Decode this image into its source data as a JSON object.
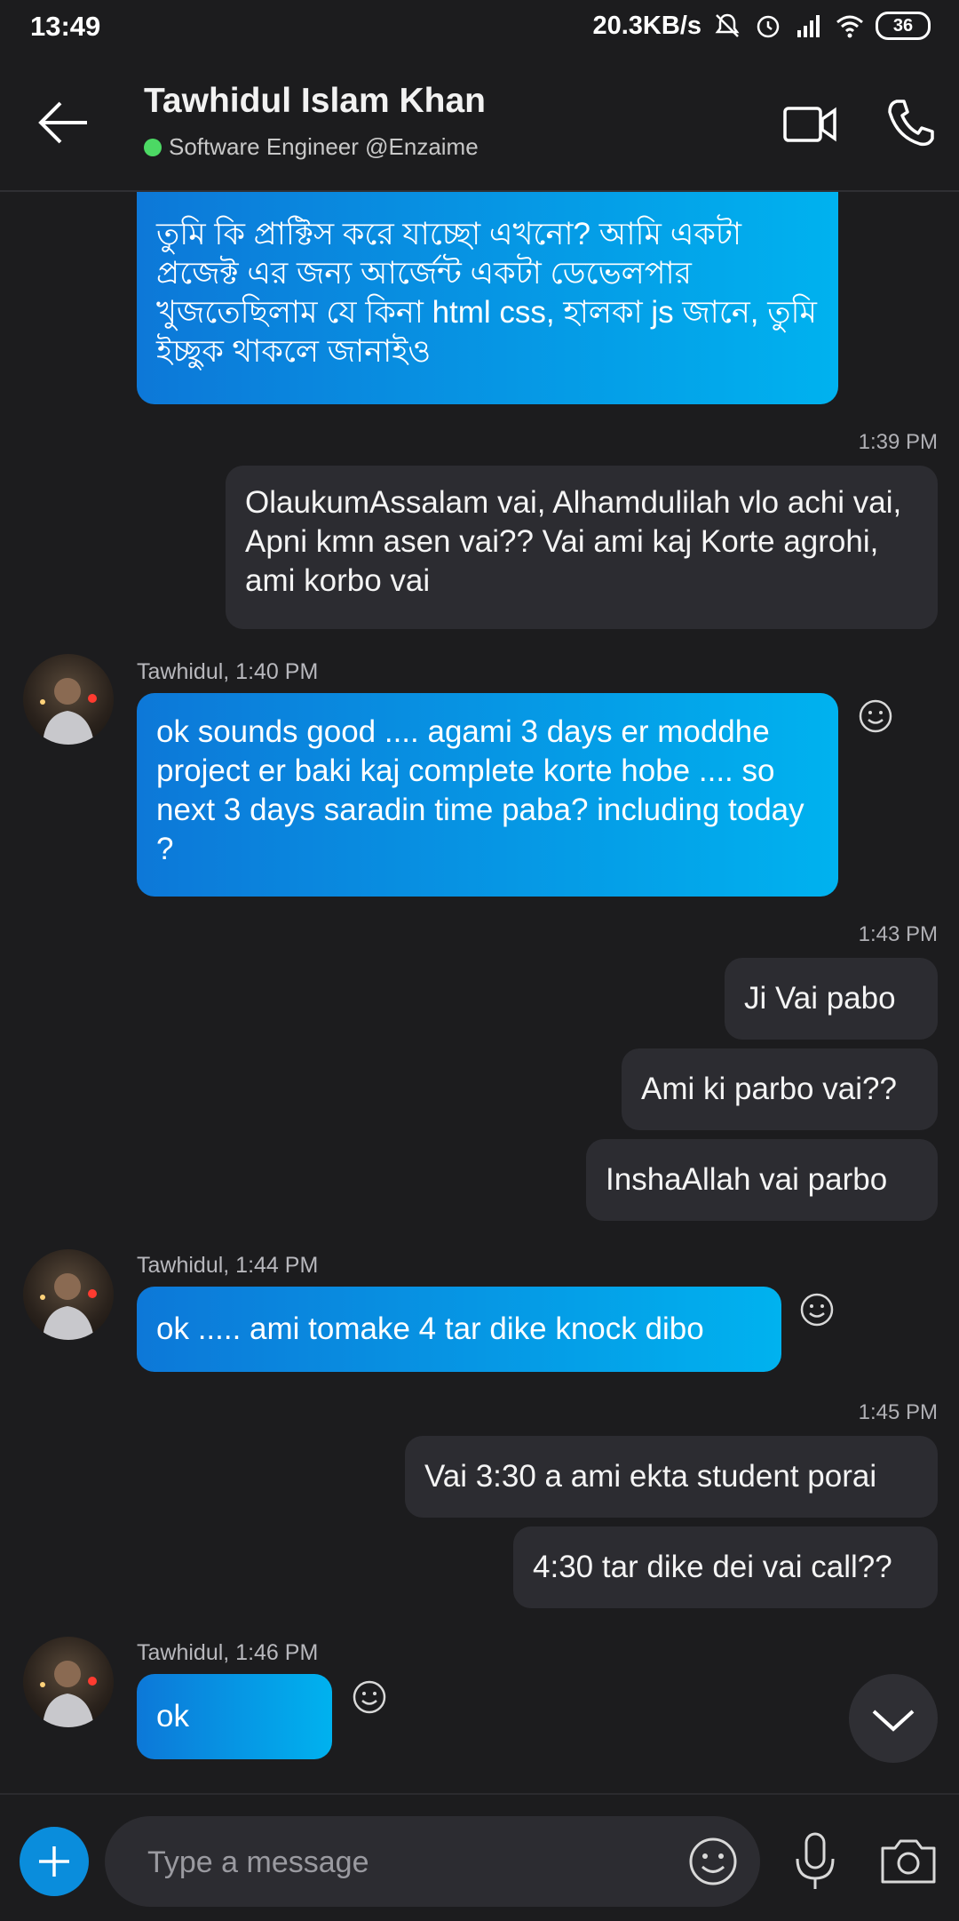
{
  "status_bar": {
    "time": "13:49",
    "network_speed": "20.3KB/s",
    "battery": "36",
    "icons": [
      "mute-icon",
      "alarm-icon",
      "signal-icon",
      "wifi-icon",
      "battery-icon"
    ]
  },
  "header": {
    "contact_name": "Tawhidul Islam Khan",
    "status": "Software Engineer @Enzaime",
    "presence_color": "#4cd964"
  },
  "messages": {
    "m1": "তুমি কি প্রাক্টিস করে যাচ্ছো এখনো? আমি একটা প্রজেক্ট এর জন্য আর্জেন্ট একটা ডেভেলপার খুজতেছিলাম যে কিনা html css,  হালকা js জানে, তুমি ইচ্ছুক থাকলে জানাইও",
    "t2": "1:39 PM",
    "m2": "OlaukumAssalam vai, Alhamdulilah vlo achi vai, Apni kmn asen vai?? Vai ami kaj Korte agrohi, ami korbo vai",
    "s3": "Tawhidul, 1:40 PM",
    "m3": "ok sounds good .... agami 3 days er moddhe project er baki kaj complete korte hobe .... so next 3 days saradin time paba? including today ?",
    "t4": "1:43 PM",
    "m4": "Ji Vai pabo",
    "m5": "Ami ki parbo vai??",
    "m6": "InshaAllah vai parbo",
    "s7": "Tawhidul, 1:44 PM",
    "m7": "ok ..... ami tomake 4 tar dike knock dibo",
    "t8": "1:45 PM",
    "m8": "Vai 3:30 a ami ekta student porai",
    "m9": "4:30 tar dike dei vai call??",
    "s10": "Tawhidul, 1:46 PM",
    "m10": "ok"
  },
  "composer": {
    "placeholder": "Type a message"
  },
  "colors": {
    "incoming_start": "#0d78d8",
    "incoming_end": "#00b2ef",
    "outgoing": "#2c2c31",
    "background": "#1c1c1e",
    "accent": "#0a8ddc"
  }
}
